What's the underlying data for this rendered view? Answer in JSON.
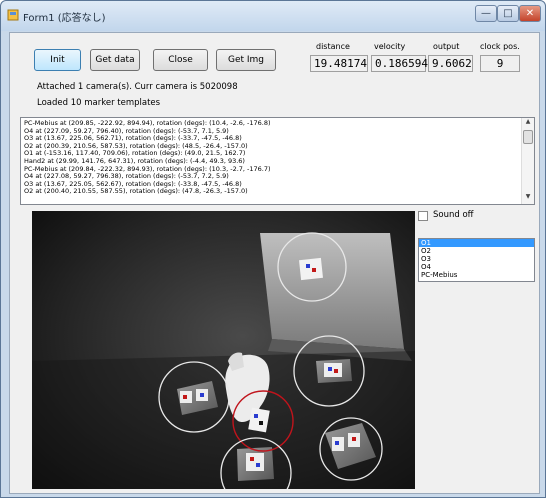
{
  "window": {
    "title": "Form1 (応答なし)",
    "min_glyph": "—",
    "max_glyph": "□",
    "close_glyph": "✕"
  },
  "toolbar": {
    "init_label": "Init",
    "get_data_label": "Get data",
    "close_label": "Close",
    "get_img_label": "Get Img"
  },
  "readouts": {
    "distance_label": "distance",
    "distance_value": "19.48174",
    "velocity_label": "velocity",
    "velocity_value": "0.186594",
    "output_label": "output",
    "output_value": "9.6062",
    "clock_label": "clock pos.",
    "clock_value": "9"
  },
  "status": {
    "camera_line": "Attached 1 camera(s). Curr camera is 5020098",
    "templates_line": "Loaded 10 marker templates"
  },
  "log": {
    "lines": [
      "PC-Mebius at (209.85, -222.92, 894.94), rotation (degs): (10.4, -2.6, -176.8)",
      "O4 at (227.09, 59.27, 796.40), rotation (degs): (-53.7, 7.1, 5.9)",
      "O3 at (13.67, 225.06, 562.71), rotation (degs): (-33.7, -47.5, -46.8)",
      "O2 at (200.39, 210.56, 587.53), rotation (degs): (48.5, -26.4, -157.0)",
      "O1 at (-153.16, 117.40, 709.06), rotation (degs): (49.0, 21.5, 162.7)",
      "Hand2 at (29.99, 141.76, 647.31), rotation (degs): (-4.4, 49.3, 93.6)",
      "PC-Mebius at (209.84, -222.32, 894.93), rotation (degs): (10.3, -2.7, -176.7)",
      "O4 at (227.08, 59.27, 796.38), rotation (degs): (-53.7, 7.2, 5.9)",
      "O3 at (13.67, 225.05, 562.67), rotation (degs): (-33.8, -47.5, -46.8)",
      "O2 at (200.40, 210.55, 587.55), rotation (degs): (47.8, -26.3, -157.0)"
    ]
  },
  "options": {
    "sound_off_label": "Sound off"
  },
  "markers": {
    "items": [
      "O1",
      "O2",
      "O3",
      "O4",
      "PC-Mebius"
    ],
    "selected": "O1"
  },
  "colors": {
    "selection": "#3399ff",
    "ring_white": "#e8e8e8",
    "ring_red": "#c0141c"
  }
}
